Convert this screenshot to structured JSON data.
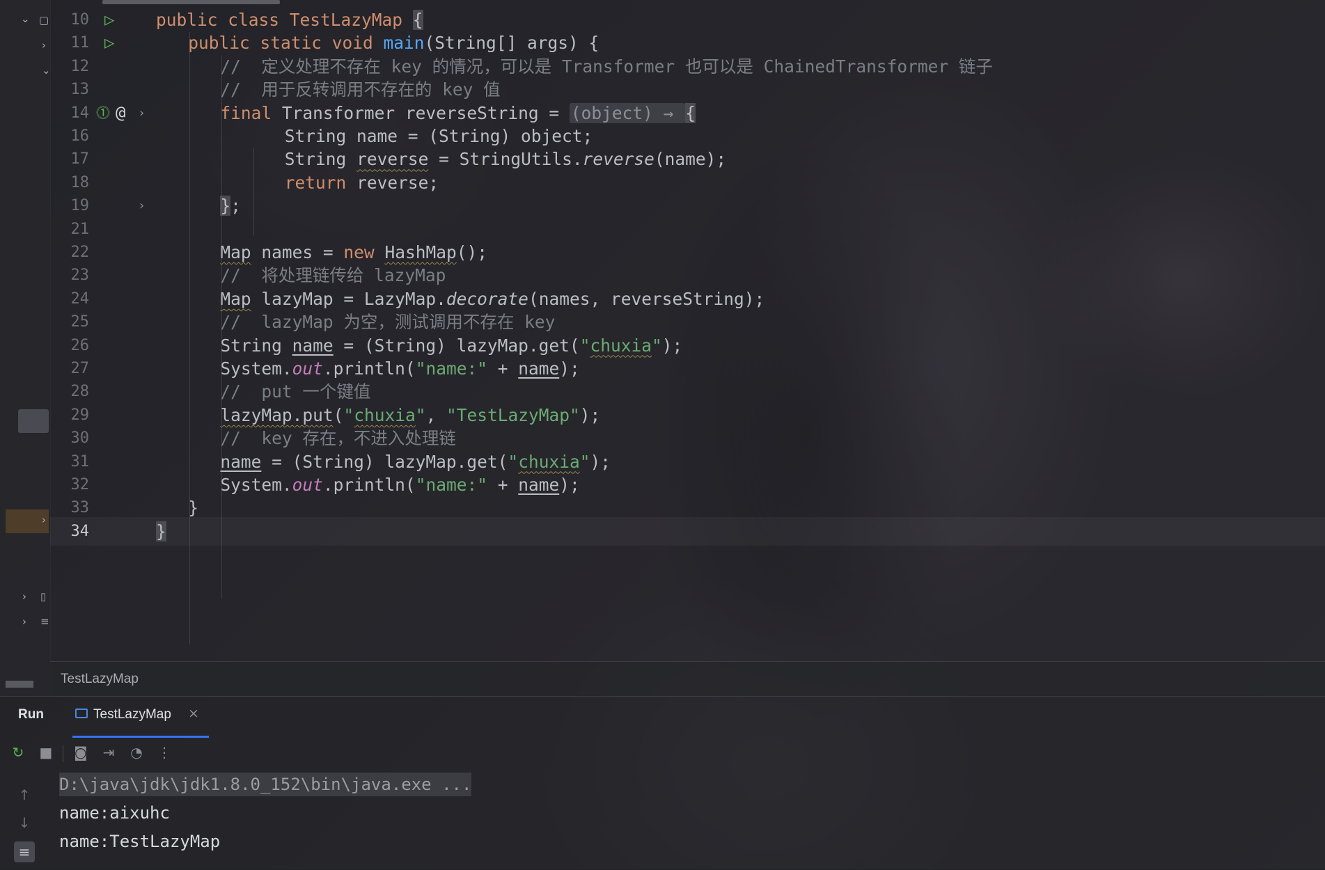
{
  "editor": {
    "file_tab": "TestLazyMap",
    "current_line": "34",
    "lines": [
      {
        "n": "10",
        "t": [
          "public class TestLazyMap ",
          "{"
        ]
      },
      {
        "n": "11",
        "t": [
          "public static void ",
          "main",
          "(String[] args) {"
        ]
      },
      {
        "n": "12",
        "t": [
          "//  定义处理不存在 key 的情况，可以是 Transformer 也可以是 ChainedTransformer 链子"
        ]
      },
      {
        "n": "13",
        "t": [
          "//  用于反转调用不存在的 key 值"
        ]
      },
      {
        "n": "14",
        "t": [
          "final ",
          "Transformer reverseString = ",
          "(object) → ",
          "{"
        ]
      },
      {
        "n": "16",
        "t": [
          "String name = (String) object;"
        ]
      },
      {
        "n": "17",
        "t": [
          "String ",
          "reverse",
          " = StringUtils.",
          "reverse",
          "(name);"
        ]
      },
      {
        "n": "18",
        "t": [
          "return ",
          "reverse;"
        ]
      },
      {
        "n": "19",
        "t": [
          "}",
          ";"
        ]
      },
      {
        "n": "21",
        "t": [
          ""
        ]
      },
      {
        "n": "22",
        "t": [
          "Map",
          " names = ",
          "new ",
          "HashMap",
          "();"
        ]
      },
      {
        "n": "23",
        "t": [
          "//  将处理链传给 lazyMap"
        ]
      },
      {
        "n": "24",
        "t": [
          "Map",
          " lazyMap = LazyMap.",
          "decorate",
          "(names, reverseString);"
        ]
      },
      {
        "n": "25",
        "t": [
          "//  lazyMap 为空，测试调用不存在 key"
        ]
      },
      {
        "n": "26",
        "t": [
          "String ",
          "name",
          " = (String) lazyMap.get(",
          "\"",
          "chuxia",
          "\"",
          ");"
        ]
      },
      {
        "n": "27",
        "t": [
          "System.",
          "out",
          ".println(",
          "\"name:\"",
          " + ",
          "name",
          ");"
        ]
      },
      {
        "n": "28",
        "t": [
          "//  put 一个键值"
        ]
      },
      {
        "n": "29",
        "t": [
          "lazyMap.put",
          "(",
          "\"",
          "chuxia",
          "\"",
          ", ",
          "\"TestLazyMap\"",
          ");"
        ]
      },
      {
        "n": "30",
        "t": [
          "//  key 存在，不进入处理链"
        ]
      },
      {
        "n": "31",
        "t": [
          "name",
          " = (String) lazyMap.get(",
          "\"",
          "chuxia",
          "\"",
          ");"
        ]
      },
      {
        "n": "32",
        "t": [
          "System.",
          "out",
          ".println(",
          "\"name:\"",
          " + ",
          "name",
          ");"
        ]
      },
      {
        "n": "33",
        "t": [
          "}"
        ]
      },
      {
        "n": "34",
        "t": [
          "}"
        ]
      }
    ]
  },
  "breadcrumb": {
    "label": "TestLazyMap"
  },
  "run_panel": {
    "title": "Run",
    "tab_label": "TestLazyMap",
    "tab_close": "×",
    "toolbar_icons": [
      "rerun-icon",
      "stop-icon",
      "screenshot-icon",
      "export-icon",
      "profiler-icon",
      "more-icon"
    ],
    "console": [
      "D:\\java\\jdk\\jdk1.8.0_152\\bin\\java.exe ...",
      "name:aixuhc",
      "name:TestLazyMap"
    ]
  },
  "colors": {
    "keyword": "#cf8e6d",
    "function": "#56a8f5",
    "string": "#6aab73",
    "comment": "#7a7e85",
    "static_field": "#c77dbb",
    "run_icon": "#5fb356",
    "tab_accent": "#3574f0"
  }
}
